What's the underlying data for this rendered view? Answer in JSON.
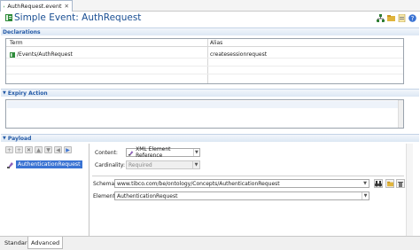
{
  "editor_tab": {
    "label": "AuthRequest.event",
    "close": "✕"
  },
  "title": "Simple Event: AuthRequest",
  "toolbar_icons": [
    "hierarchy-icon",
    "open-folder-icon",
    "open-file-icon",
    "help-icon"
  ],
  "declarations": {
    "section_label": "Declarations",
    "columns": [
      "Term",
      "Alias"
    ],
    "rows": [
      {
        "term": "/Events/AuthRequest",
        "alias": "createsessionrequest"
      }
    ]
  },
  "expiry": {
    "section_label": "Expiry Action"
  },
  "payload": {
    "section_label": "Payload",
    "tree_item": "AuthenticationRequest",
    "content_label": "Content:",
    "content_value": "XML Element Reference",
    "cardinality_label": "Cardinality:",
    "cardinality_value": "Required",
    "schema_label": "Schema:",
    "schema_value": "www.tibco.com/be/ontology/Concepts/AuthenticationRequest",
    "element_label": "Element:",
    "element_value": "AuthenticationRequest"
  },
  "bottom_tabs": [
    "Standard",
    "Advanced"
  ],
  "colors": {
    "title": "#1a4f93",
    "section_header": "#245aa6",
    "selection": "#3a73d3"
  }
}
